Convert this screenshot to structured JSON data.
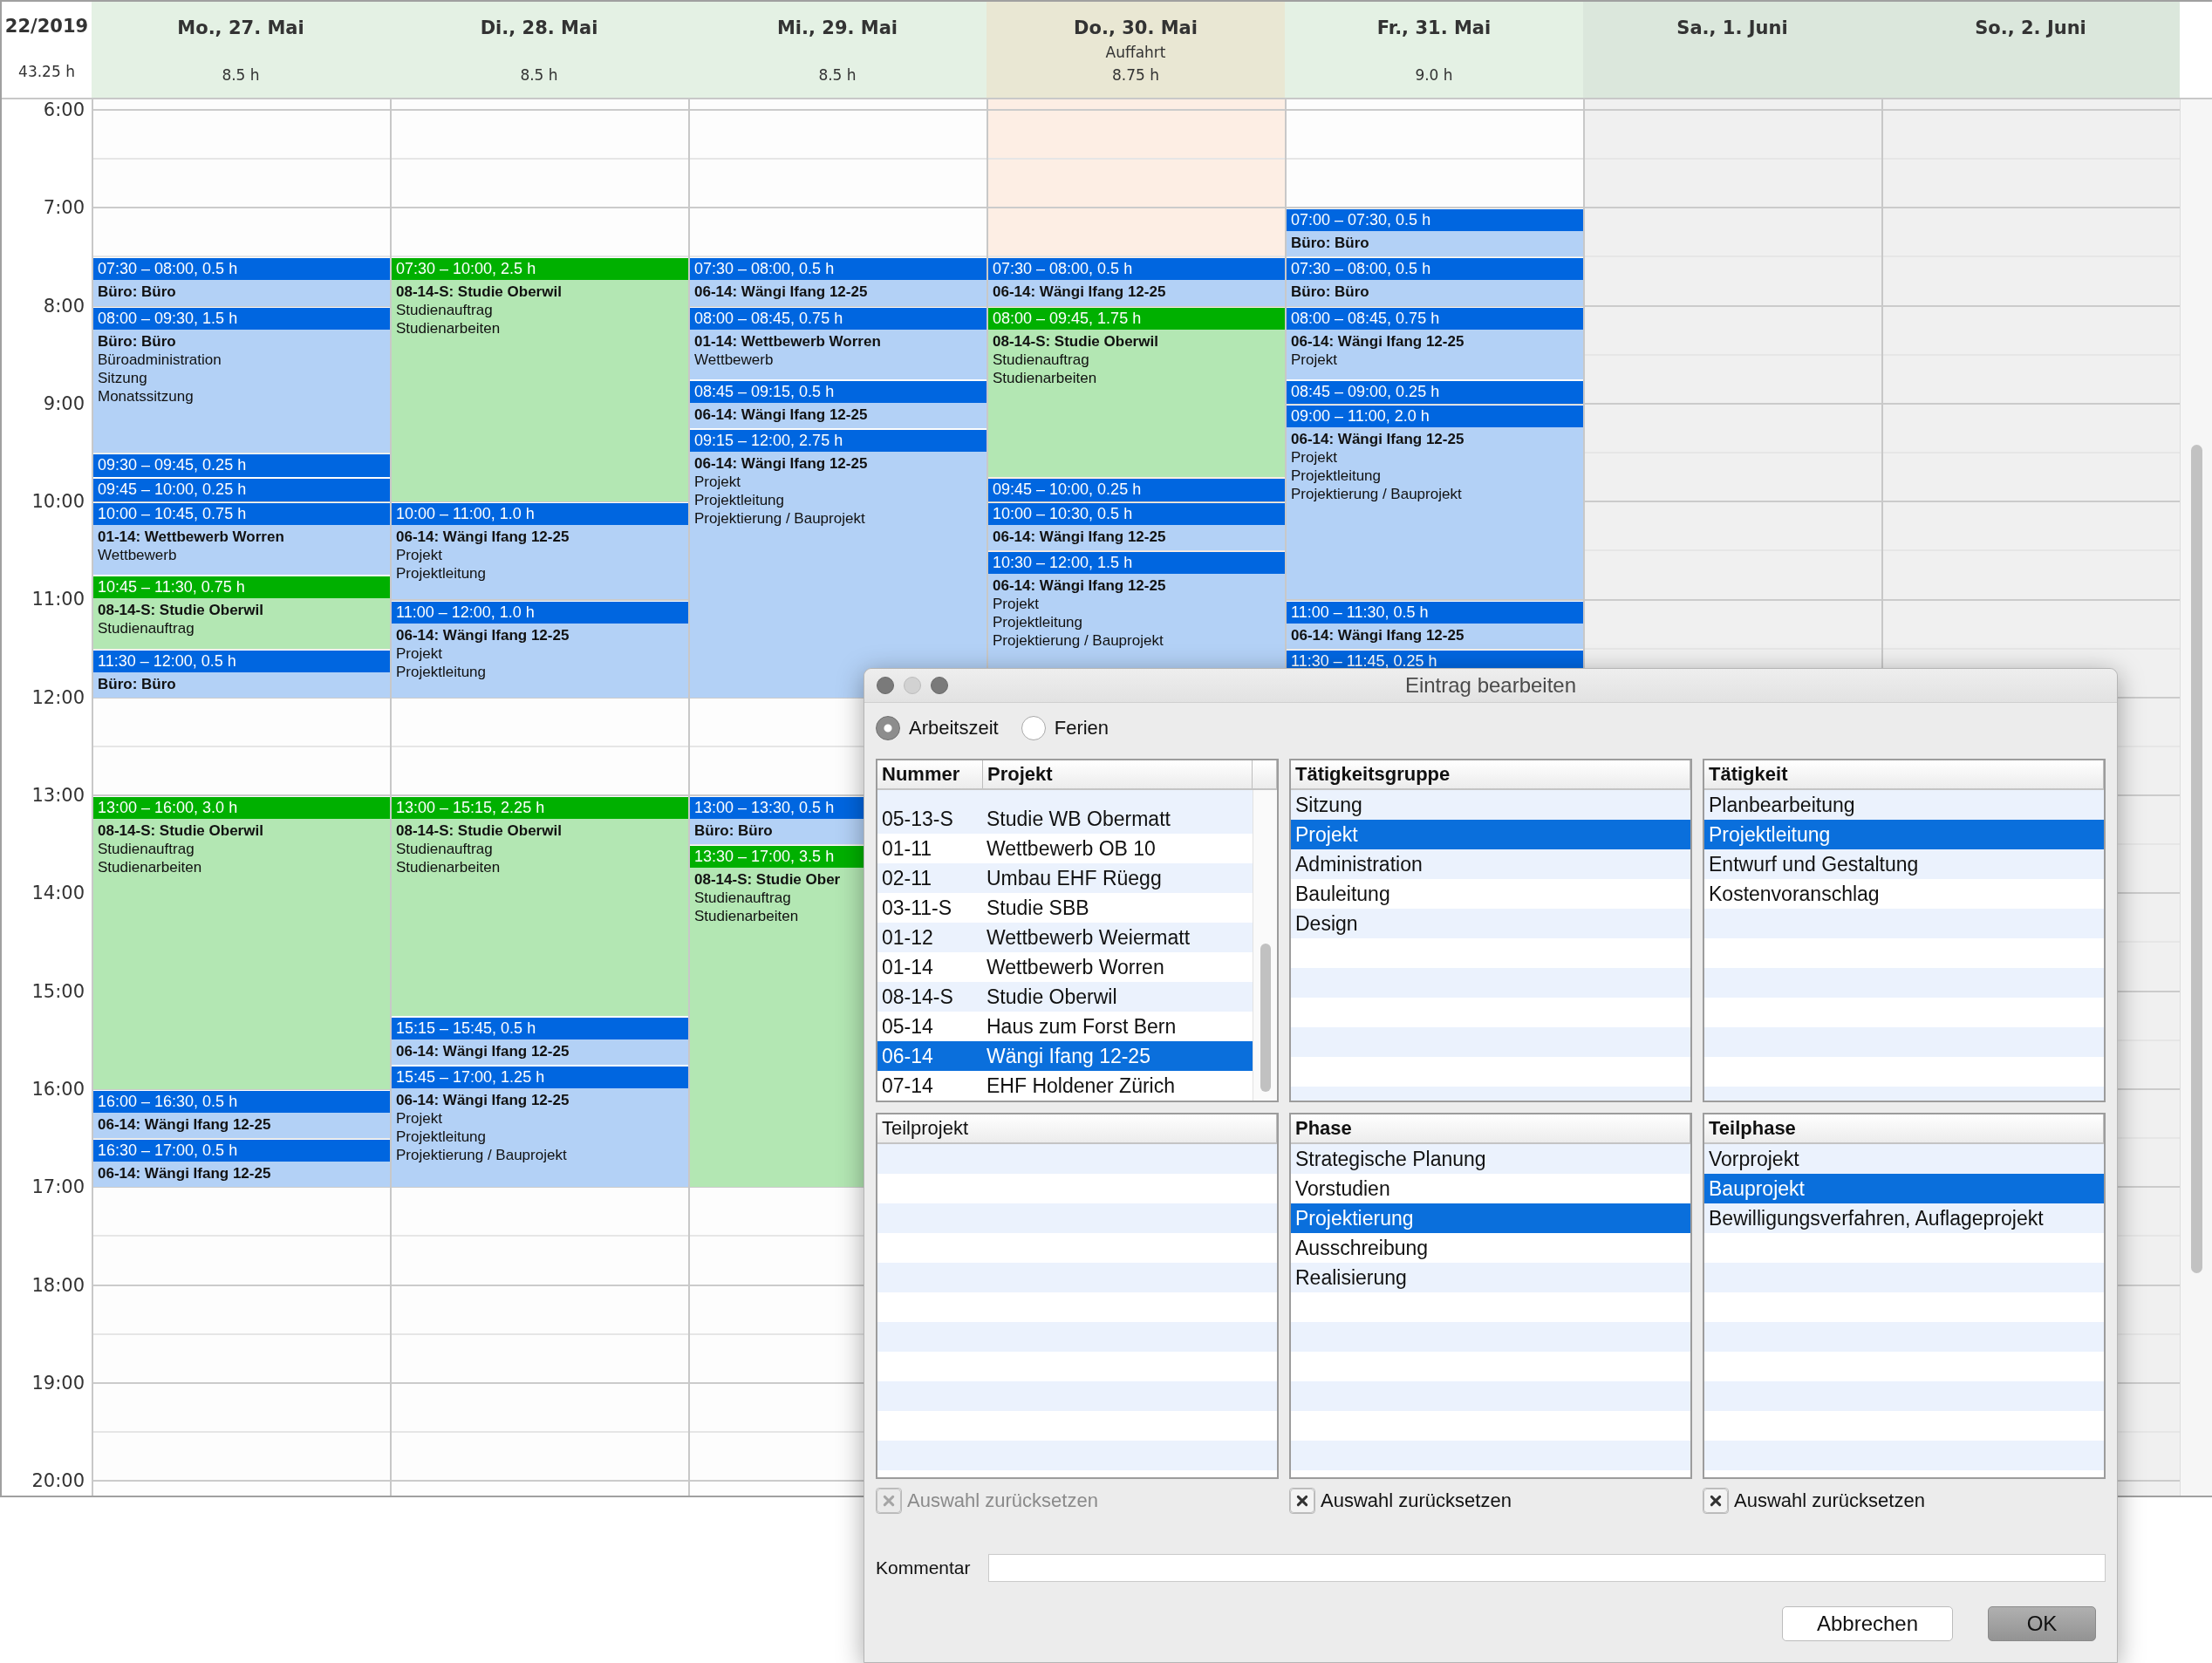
{
  "calendar": {
    "week": "22/2019",
    "total": "43.25 h",
    "hours": [
      "6:00",
      "7:00",
      "8:00",
      "9:00",
      "10:00",
      "11:00",
      "12:00",
      "13:00",
      "14:00",
      "15:00",
      "16:00",
      "17:00",
      "18:00",
      "19:00",
      "20:00"
    ],
    "days": [
      {
        "title": "Mo., 27. Mai",
        "hours": "8.5 h",
        "kind": "weekday",
        "events": [
          {
            "time": "07:30 – 08:00, 0.5 h",
            "color": "#0066e0",
            "title": "Büro: Büro"
          },
          {
            "time": "08:00 – 09:30, 1.5 h",
            "color": "#0066e0",
            "title": "Büro: Büro",
            "lines": [
              "Büroadministration",
              "Sitzung",
              "Monatssitzung"
            ]
          },
          {
            "time": "09:30 – 09:45, 0.25 h",
            "color": "#0066e0"
          },
          {
            "time": "09:45 – 10:00, 0.25 h",
            "color": "#0066e0"
          },
          {
            "time": "10:00 – 10:45, 0.75 h",
            "color": "#0066e0",
            "title": "01-14: Wettbewerb Worren",
            "lines": [
              "Wettbewerb"
            ]
          },
          {
            "time": "10:45 – 11:30, 0.75 h",
            "color": "#00b000",
            "title": "08-14-S: Studie Oberwil",
            "lines": [
              "Studienauftrag"
            ]
          },
          {
            "time": "11:30 – 12:00, 0.5 h",
            "color": "#0066e0",
            "title": "Büro: Büro"
          },
          {
            "time": "13:00 – 16:00, 3.0 h",
            "color": "#00b000",
            "title": "08-14-S: Studie Oberwil",
            "lines": [
              "Studienauftrag",
              "Studienarbeiten"
            ]
          },
          {
            "time": "16:00 – 16:30, 0.5 h",
            "color": "#0066e0",
            "title": "06-14: Wängi Ifang 12-25"
          },
          {
            "time": "16:30 – 17:00, 0.5 h",
            "color": "#0066e0",
            "title": "06-14: Wängi Ifang 12-25"
          }
        ]
      },
      {
        "title": "Di., 28. Mai",
        "hours": "8.5 h",
        "kind": "weekday",
        "events": [
          {
            "time": "07:30 – 10:00, 2.5 h",
            "color": "#00b000",
            "title": "08-14-S: Studie Oberwil",
            "lines": [
              "Studienauftrag",
              "Studienarbeiten"
            ]
          },
          {
            "time": "10:00 – 11:00, 1.0 h",
            "color": "#0066e0",
            "title": "06-14: Wängi Ifang 12-25",
            "lines": [
              "Projekt",
              "Projektleitung"
            ]
          },
          {
            "time": "11:00 – 12:00, 1.0 h",
            "color": "#0066e0",
            "title": "06-14: Wängi Ifang 12-25",
            "lines": [
              "Projekt",
              "Projektleitung"
            ]
          },
          {
            "time": "13:00 – 15:15, 2.25 h",
            "color": "#00b000",
            "title": "08-14-S: Studie Oberwil",
            "lines": [
              "Studienauftrag",
              "Studienarbeiten"
            ]
          },
          {
            "time": "15:15 – 15:45, 0.5 h",
            "color": "#0066e0",
            "title": "06-14: Wängi Ifang 12-25"
          },
          {
            "time": "15:45 – 17:00, 1.25 h",
            "color": "#0066e0",
            "title": "06-14: Wängi Ifang 12-25",
            "lines": [
              "Projekt",
              "Projektleitung",
              "Projektierung / Bauprojekt"
            ]
          }
        ]
      },
      {
        "title": "Mi., 29. Mai",
        "hours": "8.5 h",
        "kind": "weekday",
        "events": [
          {
            "time": "07:30 – 08:00, 0.5 h",
            "color": "#0066e0",
            "title": "06-14: Wängi Ifang 12-25"
          },
          {
            "time": "08:00 – 08:45, 0.75 h",
            "color": "#0066e0",
            "title": "01-14: Wettbewerb Worren",
            "lines": [
              "Wettbewerb"
            ]
          },
          {
            "time": "08:45 – 09:15, 0.5 h",
            "color": "#0066e0",
            "title": "06-14: Wängi Ifang 12-25"
          },
          {
            "time": "09:15 – 12:00, 2.75 h",
            "color": "#0066e0",
            "title": "06-14: Wängi Ifang 12-25",
            "lines": [
              "Projekt",
              "Projektleitung",
              "Projektierung / Bauprojekt"
            ]
          },
          {
            "time": "13:00 – 13:30, 0.5 h",
            "color": "#0066e0",
            "title": "Büro: Büro"
          },
          {
            "time": "13:30 – 17:00, 3.5 h",
            "color": "#00b000",
            "title": "08-14-S: Studie Ober",
            "lines": [
              "Studienauftrag",
              "Studienarbeiten"
            ]
          }
        ]
      },
      {
        "title": "Do., 30. Mai",
        "note": "Auffahrt",
        "hours": "8.75 h",
        "kind": "holiday",
        "events": [
          {
            "time": "07:30 – 08:00, 0.5 h",
            "color": "#0066e0",
            "title": "06-14: Wängi Ifang 12-25"
          },
          {
            "time": "08:00 – 09:45, 1.75 h",
            "color": "#00b000",
            "title": "08-14-S: Studie Oberwil",
            "lines": [
              "Studienauftrag",
              "Studienarbeiten"
            ]
          },
          {
            "time": "09:45 – 10:00, 0.25 h",
            "color": "#0066e0"
          },
          {
            "time": "10:00 – 10:30, 0.5 h",
            "color": "#0066e0",
            "title": "06-14: Wängi Ifang 12-25"
          },
          {
            "time": "10:30 – 12:00, 1.5 h",
            "color": "#0066e0",
            "title": "06-14: Wängi Ifang 12-25",
            "lines": [
              "Projekt",
              "Projektleitung",
              "Projektierung / Bauprojekt"
            ]
          }
        ]
      },
      {
        "title": "Fr., 31. Mai",
        "hours": "9.0 h",
        "kind": "weekday",
        "events": [
          {
            "time": "07:00 – 07:30, 0.5 h",
            "color": "#0066e0",
            "title": "Büro: Büro"
          },
          {
            "time": "07:30 – 08:00, 0.5 h",
            "color": "#0066e0",
            "title": "Büro: Büro"
          },
          {
            "time": "08:00 – 08:45, 0.75 h",
            "color": "#0066e0",
            "title": "06-14: Wängi Ifang 12-25",
            "lines": [
              "Projekt"
            ]
          },
          {
            "time": "08:45 – 09:00, 0.25 h",
            "color": "#0066e0"
          },
          {
            "time": "09:00 – 11:00, 2.0 h",
            "color": "#0066e0",
            "title": "06-14: Wängi Ifang 12-25",
            "lines": [
              "Projekt",
              "Projektleitung",
              "Projektierung / Bauprojekt"
            ]
          },
          {
            "time": "11:00 – 11:30, 0.5 h",
            "color": "#0066e0",
            "title": "06-14: Wängi Ifang 12-25"
          },
          {
            "time": "11:30 – 11:45, 0.25 h",
            "color": "#0066e0"
          }
        ]
      },
      {
        "title": "Sa., 1. Juni",
        "kind": "weekend"
      },
      {
        "title": "So., 2. Juni",
        "kind": "weekend"
      }
    ]
  },
  "dialog": {
    "title": "Eintrag bearbeiten",
    "radios": [
      {
        "label": "Arbeitszeit",
        "selected": true
      },
      {
        "label": "Ferien",
        "selected": false
      }
    ],
    "lists": [
      {
        "kind": "table",
        "disabled": false,
        "columns": [
          "Nummer",
          "Projekt"
        ],
        "rows": [
          {
            "cells": [
              "05-13-S",
              "Studie WB Obermatt"
            ],
            "selected": false
          },
          {
            "cells": [
              "01-11",
              "Wettbewerb OB 10"
            ],
            "selected": false
          },
          {
            "cells": [
              "02-11",
              "Umbau EHF Rüegg"
            ],
            "selected": false
          },
          {
            "cells": [
              "03-11-S",
              "Studie SBB"
            ],
            "selected": false
          },
          {
            "cells": [
              "01-12",
              "Wettbewerb Weiermatt"
            ],
            "selected": false
          },
          {
            "cells": [
              "01-14",
              "Wettbewerb Worren"
            ],
            "selected": false
          },
          {
            "cells": [
              "08-14-S",
              "Studie Oberwil"
            ],
            "selected": false
          },
          {
            "cells": [
              "05-14",
              "Haus zum Forst Bern"
            ],
            "selected": false
          },
          {
            "cells": [
              "06-14",
              "Wängi Ifang 12-25"
            ],
            "selected": true
          },
          {
            "cells": [
              "07-14",
              "EHF Holdener Zürich"
            ],
            "selected": false
          }
        ]
      },
      {
        "kind": "list",
        "disabled": false,
        "columns": [
          "Tätigkeitsgruppe"
        ],
        "rows": [
          {
            "cells": [
              "Sitzung"
            ],
            "selected": false
          },
          {
            "cells": [
              "Projekt"
            ],
            "selected": true
          },
          {
            "cells": [
              "Administration"
            ],
            "selected": false
          },
          {
            "cells": [
              "Bauleitung"
            ],
            "selected": false
          },
          {
            "cells": [
              "Design"
            ],
            "selected": false
          }
        ]
      },
      {
        "kind": "list",
        "disabled": false,
        "columns": [
          "Tätigkeit"
        ],
        "rows": [
          {
            "cells": [
              "Planbearbeitung"
            ],
            "selected": false
          },
          {
            "cells": [
              "Projektleitung"
            ],
            "selected": true
          },
          {
            "cells": [
              "Entwurf und Gestaltung"
            ],
            "selected": false
          },
          {
            "cells": [
              "Kostenvoranschlag"
            ],
            "selected": false
          }
        ]
      },
      {
        "kind": "list",
        "disabled": true,
        "columns": [
          "Teilprojekt"
        ]
      },
      {
        "kind": "list",
        "disabled": false,
        "columns": [
          "Phase"
        ],
        "rows": [
          {
            "cells": [
              "Strategische Planung"
            ],
            "selected": false
          },
          {
            "cells": [
              "Vorstudien"
            ],
            "selected": false
          },
          {
            "cells": [
              "Projektierung"
            ],
            "selected": true
          },
          {
            "cells": [
              "Ausschreibung"
            ],
            "selected": false
          },
          {
            "cells": [
              "Realisierung"
            ],
            "selected": false
          }
        ]
      },
      {
        "kind": "list",
        "disabled": false,
        "columns": [
          "Teilphase"
        ],
        "rows": [
          {
            "cells": [
              "Vorprojekt"
            ],
            "selected": false
          },
          {
            "cells": [
              "Bauprojekt"
            ],
            "selected": true
          },
          {
            "cells": [
              "Bewilligungsverfahren, Auflageprojekt"
            ],
            "selected": false
          }
        ]
      }
    ],
    "reset_buttons": [
      {
        "label": "Auswahl zurücksetzen",
        "disabled": true
      },
      {
        "label": "Auswahl zurücksetzen",
        "disabled": false
      },
      {
        "label": "Auswahl zurücksetzen",
        "disabled": false
      }
    ],
    "comment": {
      "label": "Kommentar"
    },
    "buttons": [
      {
        "label": "Abbrechen",
        "kind": "normal"
      },
      {
        "label": "OK",
        "kind": "default"
      }
    ]
  }
}
